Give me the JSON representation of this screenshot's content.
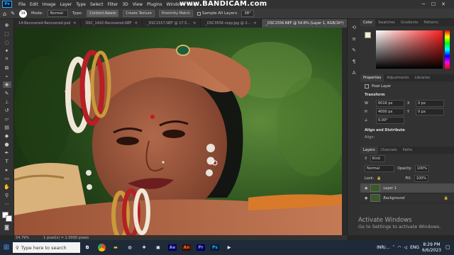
{
  "menubar": {
    "logo": "Ps",
    "items": [
      "File",
      "Edit",
      "Image",
      "Layer",
      "Type",
      "Select",
      "Filter",
      "3D",
      "View",
      "Plugins",
      "Window",
      "Help"
    ]
  },
  "watermark_top": "www.BANDICAM.com",
  "options": {
    "size": "19",
    "mode_label": "Mode:",
    "mode_value": "Normal",
    "type_label": "Type:",
    "content_aware": "Content-Aware",
    "create_texture": "Create Texture",
    "proximity_match": "Proximity Match",
    "sample_all_layers": "Sample All Layers",
    "angle": "38°"
  },
  "tabs": [
    {
      "label": "14-Recovered-Recovered.psd",
      "active": false
    },
    {
      "label": "DSC_1442-Recovered.NEF",
      "active": false
    },
    {
      "label": "_DSC1557.NEF @ 17.5...",
      "active": false
    },
    {
      "label": "_DSC3556 copy.jpg @ 2...",
      "active": false
    },
    {
      "label": "_DSC1556.NEF @ 54.8% (Layer 1, RGB/16*)",
      "active": true
    }
  ],
  "status": {
    "zoom": "54.79%",
    "info": "1 pixel(s) = 1.0000 pixels"
  },
  "color_panel": {
    "tabs": [
      "Color",
      "Swatches",
      "Gradients",
      "Patterns"
    ]
  },
  "properties": {
    "tabs": [
      "Properties",
      "Adjustments",
      "Libraries"
    ],
    "kind": "Pixel Layer",
    "transform": "Transform",
    "w": "6016 px",
    "h": "4000 px",
    "x": "0 px",
    "y": "0 px",
    "angle": "0.00°",
    "align": "Align and Distribute",
    "align_label": "Align:"
  },
  "layers_panel": {
    "tabs": [
      "Layers",
      "Channels",
      "Paths"
    ],
    "filter": "Kind",
    "blend": "Normal",
    "opacity_label": "Opacity:",
    "opacity": "100%",
    "lock_label": "Lock:",
    "fill_label": "Fill:",
    "fill": "100%",
    "layers": [
      {
        "name": "Layer 1",
        "selected": true
      },
      {
        "name": "Background",
        "selected": false
      }
    ]
  },
  "activate": {
    "title": "Activate Windows",
    "sub": "Go to Settings to activate Windows."
  },
  "taskbar": {
    "search_placeholder": "Type here to search",
    "apps": [
      "Ae",
      "An",
      "Pr",
      "Ps"
    ],
    "lang": "ENG",
    "currency": "INR/...",
    "time": "8:29 PM",
    "date": "6/6/2023"
  },
  "colors": {
    "accent": "#31a8ff",
    "panel": "#323232",
    "taskbar": "#1e2a38"
  }
}
